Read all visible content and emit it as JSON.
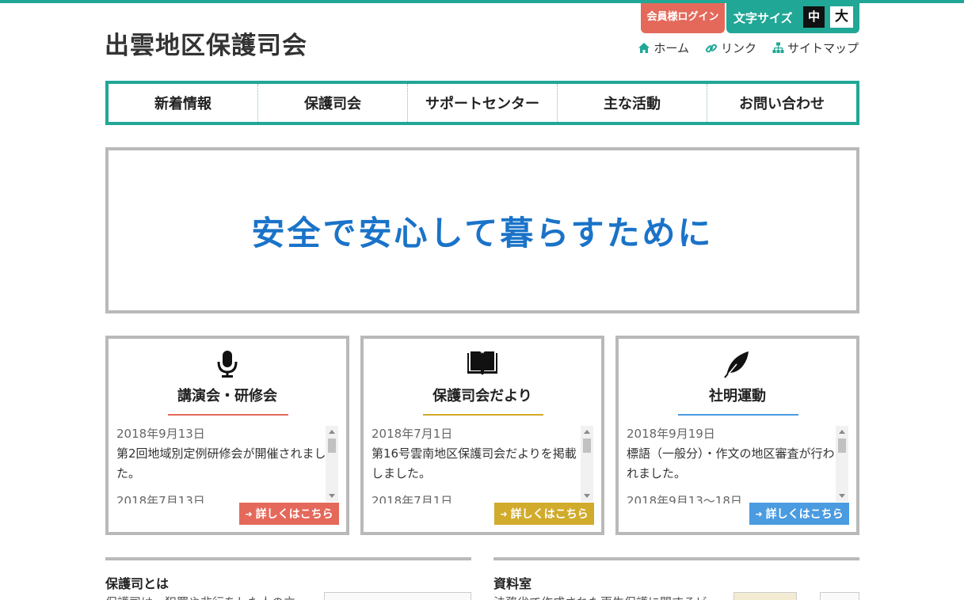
{
  "site": {
    "title": "出雲地区保護司会"
  },
  "header": {
    "login_label": "会員様ログイン",
    "font_size_label": "文字サイズ",
    "font_size_medium": "中",
    "font_size_large": "大",
    "links": [
      {
        "label": "ホーム",
        "icon": "home-icon"
      },
      {
        "label": "リンク",
        "icon": "link-icon"
      },
      {
        "label": "サイトマップ",
        "icon": "sitemap-icon"
      }
    ]
  },
  "nav": {
    "items": [
      "新着情報",
      "保護司会",
      "サポートセンター",
      "主な活動",
      "お問い合わせ"
    ]
  },
  "hero": {
    "text": "安全で安心して暮らすために"
  },
  "cards": [
    {
      "title": "講演会・研修会",
      "icon": "microphone-icon",
      "accent": "#e4695b",
      "news": [
        {
          "date": "2018年9月13日",
          "text": "第2回地域別定例研修会が開催されました。"
        },
        {
          "date": "2018年7月13日",
          "text": ""
        }
      ],
      "more_label": "詳しくはこちら"
    },
    {
      "title": "保護司会だより",
      "icon": "book-icon",
      "accent": "#d1ab2b",
      "news": [
        {
          "date": "2018年7月1日",
          "text": "第16号雲南地区保護司会だよりを掲載しました。"
        },
        {
          "date": "2018年7月1日",
          "text": ""
        }
      ],
      "more_label": "詳しくはこちら"
    },
    {
      "title": "社明運動",
      "icon": "feather-icon",
      "accent": "#4a9be0",
      "news": [
        {
          "date": "2018年9月19日",
          "text": "標語（一般分）・作文の地区審査が行われました。"
        },
        {
          "date": "2018年9月13〜18日",
          "text": ""
        }
      ],
      "more_label": "詳しくはこちら"
    }
  ],
  "sections": [
    {
      "title": "保護司とは",
      "text": "保護司は、犯罪や非行をした人の立"
    },
    {
      "title": "資料室",
      "text": "法務省で作成された更生保護に関するビ"
    }
  ],
  "colors": {
    "brand": "#21a796",
    "login": "#e4695b",
    "hero_text": "#1a73c8"
  }
}
